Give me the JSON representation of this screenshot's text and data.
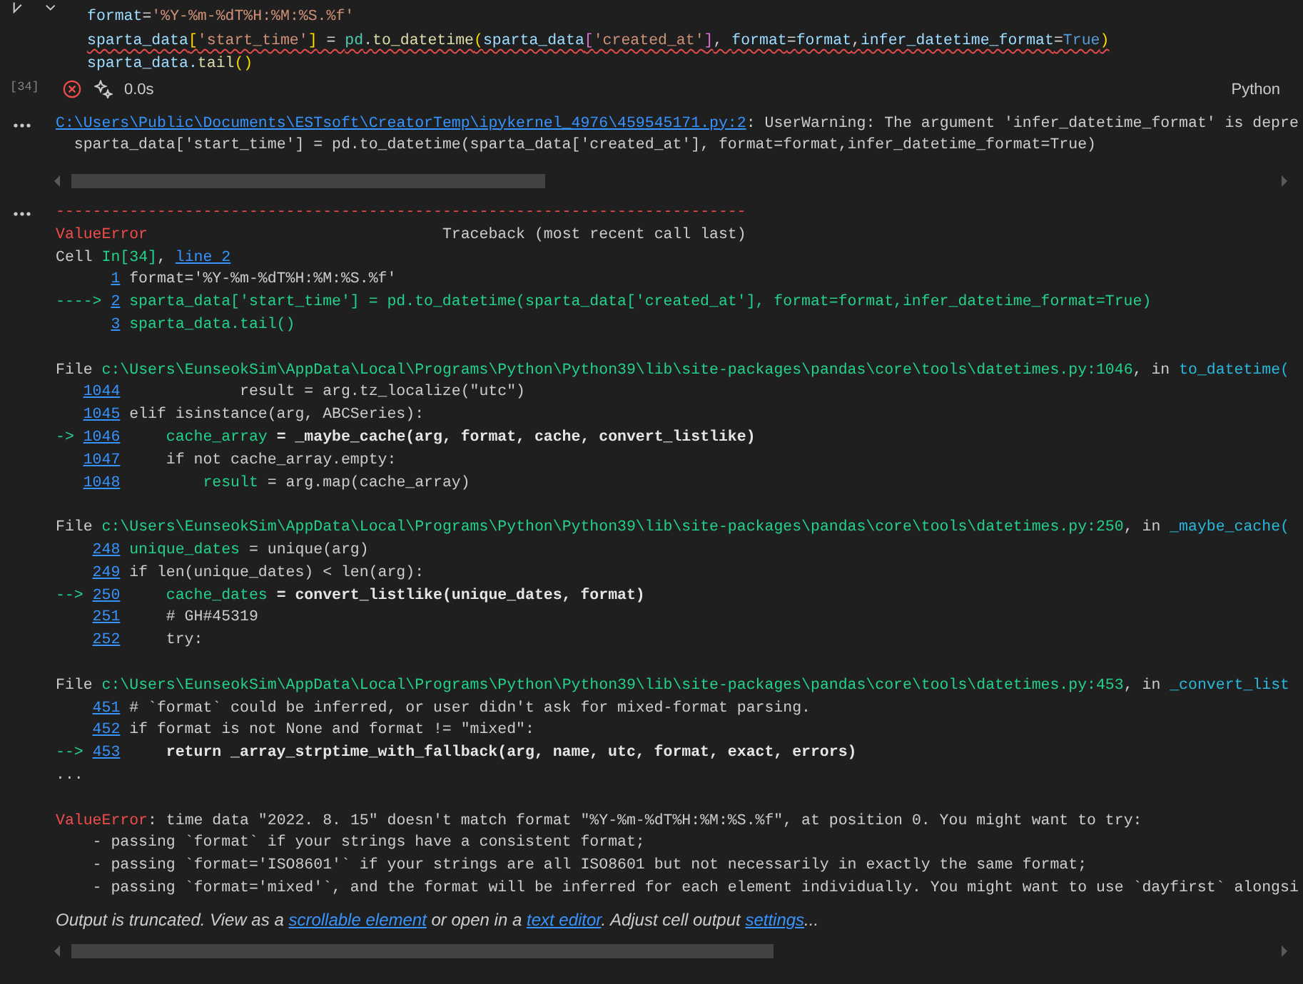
{
  "cell": {
    "execution_count": "[34]",
    "failed": true,
    "duration": "0.0s",
    "language": "Python",
    "code": [
      {
        "tokens": [
          {
            "text": "format",
            "kind": "var"
          },
          {
            "text": "=",
            "kind": "plain"
          },
          {
            "text": "'%Y-%m-%dT%H:%M:%S.%f'",
            "kind": "string"
          }
        ]
      },
      {
        "squiggle": true,
        "tokens": [
          {
            "text": "sparta_data",
            "kind": "var"
          },
          {
            "text": "[",
            "kind": "br1"
          },
          {
            "text": "'start_time'",
            "kind": "string"
          },
          {
            "text": "]",
            "kind": "br1"
          },
          {
            "text": " = ",
            "kind": "plain"
          },
          {
            "text": "pd",
            "kind": "module"
          },
          {
            "text": ".",
            "kind": "plain"
          },
          {
            "text": "to_datetime",
            "kind": "func"
          },
          {
            "text": "(",
            "kind": "br1"
          },
          {
            "text": "sparta_data",
            "kind": "var"
          },
          {
            "text": "[",
            "kind": "br2"
          },
          {
            "text": "'created_at'",
            "kind": "string"
          },
          {
            "text": "]",
            "kind": "br2"
          },
          {
            "text": ", ",
            "kind": "plain"
          },
          {
            "text": "format",
            "kind": "var"
          },
          {
            "text": "=",
            "kind": "plain"
          },
          {
            "text": "format",
            "kind": "var"
          },
          {
            "text": ",",
            "kind": "plain"
          },
          {
            "text": "infer_datetime_format",
            "kind": "var"
          },
          {
            "text": "=",
            "kind": "plain"
          },
          {
            "text": "True",
            "kind": "const"
          },
          {
            "text": ")",
            "kind": "br1"
          }
        ]
      },
      {
        "tokens": [
          {
            "text": "sparta_data.",
            "kind": "var"
          },
          {
            "text": "tail",
            "kind": "func"
          },
          {
            "text": "()",
            "kind": "br1"
          }
        ]
      }
    ]
  },
  "outputs": [
    {
      "kind": "warning",
      "lines": [
        {
          "kind": "text",
          "tokens": [
            {
              "text": "C:\\Users\\Public\\Documents\\ESTsoft\\CreatorTemp\\ipykernel_4976\\459545171.py:2",
              "kind": "link"
            },
            {
              "text": ": UserWarning: The argument 'infer_datetime_format' is depre",
              "kind": "plain"
            }
          ]
        },
        {
          "kind": "text",
          "tokens": [
            {
              "text": "  sparta_data['start_time'] = pd.to_datetime(sparta_data['created_at'], format=format,infer_datetime_format=True)",
              "kind": "plain"
            }
          ]
        }
      ]
    },
    {
      "kind": "error",
      "lines": [
        {
          "kind": "text",
          "tokens": [
            {
              "text": "---------------------------------------------------------------------------",
              "kind": "error"
            }
          ]
        },
        {
          "kind": "text",
          "tokens": [
            {
              "text": "ValueError",
              "kind": "error"
            },
            {
              "text": "                                Traceback (most recent call last)",
              "kind": "plain"
            }
          ]
        },
        {
          "kind": "text",
          "tokens": [
            {
              "text": "Cell ",
              "kind": "plain"
            },
            {
              "text": "In[34]",
              "kind": "green"
            },
            {
              "text": ", ",
              "kind": "plain"
            },
            {
              "text": "line 2",
              "kind": "link"
            }
          ]
        },
        {
          "kind": "frame",
          "lineno": "1",
          "tokens": [
            {
              "text": "format='%Y-%m-%dT%H:%M:%S.%f'",
              "kind": "plain"
            }
          ]
        },
        {
          "kind": "frame",
          "marker": "----> ",
          "lineno": "2",
          "tokens": [
            {
              "text": "sparta_data['start_time'] = pd.to_datetime(sparta_data['created_at'], format=format,infer_datetime_format=True)",
              "kind": "green"
            }
          ]
        },
        {
          "kind": "frame",
          "lineno": "3",
          "tokens": [
            {
              "text": "sparta_data.tail()",
              "kind": "green"
            }
          ]
        },
        {
          "kind": "blank"
        },
        {
          "kind": "text",
          "tokens": [
            {
              "text": "File ",
              "kind": "plain"
            },
            {
              "text": "c:\\Users\\EunseokSim\\AppData\\Local\\Programs\\Python\\Python39\\lib\\site-packages\\pandas\\core\\tools\\datetimes.py:1046",
              "kind": "green"
            },
            {
              "text": ", in ",
              "kind": "plain"
            },
            {
              "text": "to_datetime(",
              "kind": "cyan"
            }
          ]
        },
        {
          "kind": "frame",
          "lineno": "1044",
          "tokens": [
            {
              "text": "            result = arg.tz_localize(\"utc\")",
              "kind": "plain"
            }
          ]
        },
        {
          "kind": "frame",
          "lineno": "1045",
          "tokens": [
            {
              "text": "elif isinstance(arg, ABCSeries):",
              "kind": "plain"
            }
          ]
        },
        {
          "kind": "frame",
          "marker": "-> ",
          "lineno": "1046",
          "tokens": [
            {
              "text": "    cache_array",
              "kind": "green"
            },
            {
              "text": " = _maybe_cache(arg, format, cache, convert_listlike)",
              "kind": "bold"
            }
          ]
        },
        {
          "kind": "frame",
          "lineno": "1047",
          "tokens": [
            {
              "text": "    if not cache_array.empty:",
              "kind": "plain"
            }
          ]
        },
        {
          "kind": "frame",
          "lineno": "1048",
          "tokens": [
            {
              "text": "        result",
              "kind": "green"
            },
            {
              "text": " = arg.map(cache_array)",
              "kind": "plain"
            }
          ]
        },
        {
          "kind": "blank"
        },
        {
          "kind": "text",
          "tokens": [
            {
              "text": "File ",
              "kind": "plain"
            },
            {
              "text": "c:\\Users\\EunseokSim\\AppData\\Local\\Programs\\Python\\Python39\\lib\\site-packages\\pandas\\core\\tools\\datetimes.py:250",
              "kind": "green"
            },
            {
              "text": ", in ",
              "kind": "plain"
            },
            {
              "text": "_maybe_cache(",
              "kind": "cyan"
            }
          ]
        },
        {
          "kind": "frame",
          "lineno": "248",
          "tokens": [
            {
              "text": "unique_dates",
              "kind": "green"
            },
            {
              "text": " = unique(arg)",
              "kind": "plain"
            }
          ]
        },
        {
          "kind": "frame",
          "lineno": "249",
          "tokens": [
            {
              "text": "if len(unique_dates) < len(arg):",
              "kind": "plain"
            }
          ]
        },
        {
          "kind": "frame",
          "marker": "--> ",
          "lineno": "250",
          "tokens": [
            {
              "text": "    cache_dates",
              "kind": "green"
            },
            {
              "text": " = convert_listlike(unique_dates, format)",
              "kind": "bold"
            }
          ]
        },
        {
          "kind": "frame",
          "lineno": "251",
          "tokens": [
            {
              "text": "    # GH#45319",
              "kind": "plain"
            }
          ]
        },
        {
          "kind": "frame",
          "lineno": "252",
          "tokens": [
            {
              "text": "    try:",
              "kind": "plain"
            }
          ]
        },
        {
          "kind": "blank"
        },
        {
          "kind": "text",
          "tokens": [
            {
              "text": "File ",
              "kind": "plain"
            },
            {
              "text": "c:\\Users\\EunseokSim\\AppData\\Local\\Programs\\Python\\Python39\\lib\\site-packages\\pandas\\core\\tools\\datetimes.py:453",
              "kind": "green"
            },
            {
              "text": ", in ",
              "kind": "plain"
            },
            {
              "text": "_convert_list",
              "kind": "cyan"
            }
          ]
        },
        {
          "kind": "frame",
          "lineno": "451",
          "tokens": [
            {
              "text": "# `format` could be inferred, or user didn't ask for mixed-format parsing.",
              "kind": "plain"
            }
          ]
        },
        {
          "kind": "frame",
          "lineno": "452",
          "tokens": [
            {
              "text": "if format is not None and format != \"mixed\":",
              "kind": "plain"
            }
          ]
        },
        {
          "kind": "frame",
          "marker": "--> ",
          "lineno": "453",
          "tokens": [
            {
              "text": "    return _array_strptime_with_fallback(arg, name, utc, format, exact, errors)",
              "kind": "bold"
            }
          ]
        },
        {
          "kind": "text",
          "tokens": [
            {
              "text": "...",
              "kind": "plain"
            }
          ]
        },
        {
          "kind": "blank"
        },
        {
          "kind": "text",
          "tokens": [
            {
              "text": "ValueError",
              "kind": "error"
            },
            {
              "text": ": time data \"2022. 8. 15\" doesn't match format \"%Y-%m-%dT%H:%M:%S.%f\", at position 0. You might want to try:",
              "kind": "plain"
            }
          ]
        },
        {
          "kind": "text",
          "tokens": [
            {
              "text": "    - passing `format` if your strings have a consistent format;",
              "kind": "plain"
            }
          ]
        },
        {
          "kind": "text",
          "tokens": [
            {
              "text": "    - passing `format='ISO8601'` if your strings are all ISO8601 but not necessarily in exactly the same format;",
              "kind": "plain"
            }
          ]
        },
        {
          "kind": "text",
          "tokens": [
            {
              "text": "    - passing `format='mixed'`, and the format will be inferred for each element individually. You might want to use `dayfirst` alongsi",
              "kind": "plain"
            }
          ]
        }
      ],
      "notice": [
        {
          "text": "Output is truncated. View as a ",
          "kind": "plain"
        },
        {
          "text": "scrollable element",
          "kind": "link"
        },
        {
          "text": " or open in a ",
          "kind": "plain"
        },
        {
          "text": "text editor",
          "kind": "link"
        },
        {
          "text": ". Adjust cell output ",
          "kind": "plain"
        },
        {
          "text": "settings",
          "kind": "link"
        },
        {
          "text": "...",
          "kind": "plain"
        }
      ]
    }
  ]
}
